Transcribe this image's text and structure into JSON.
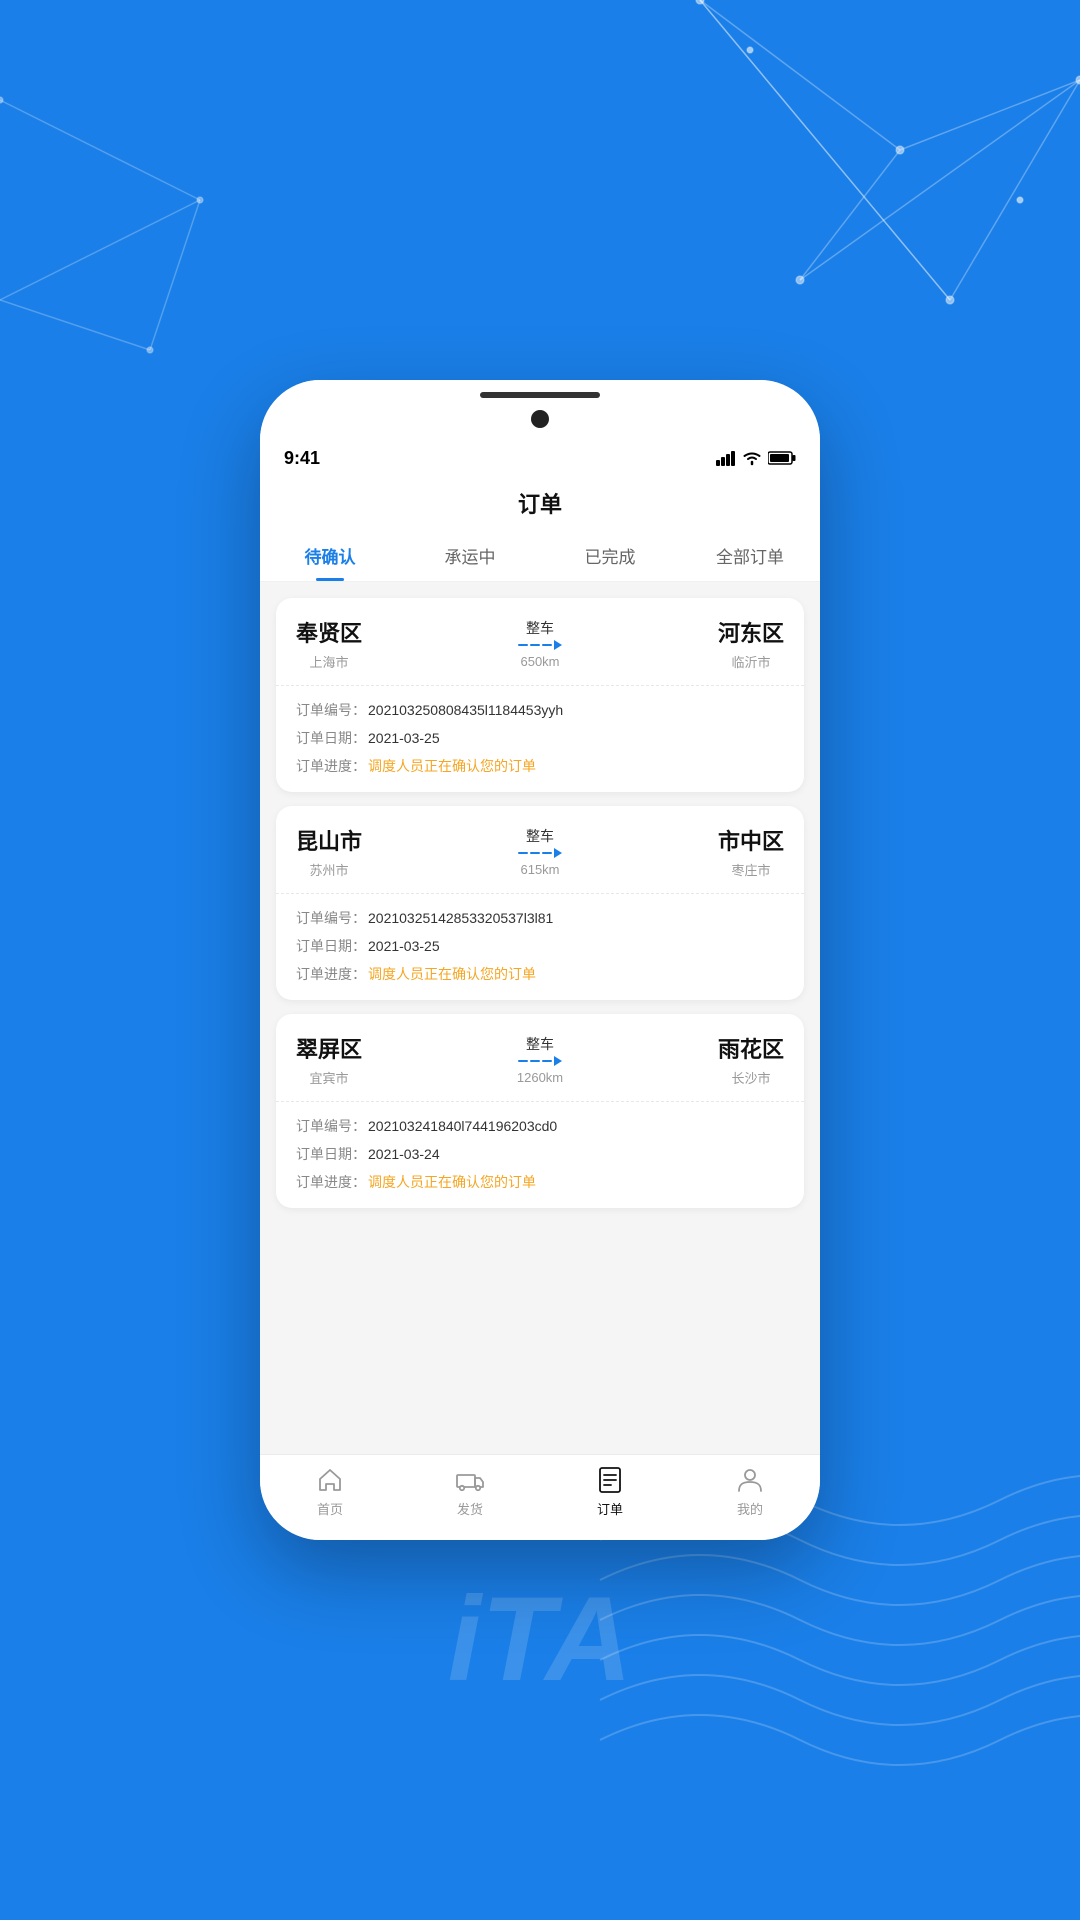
{
  "background": {
    "color": "#1a7fe8"
  },
  "status_bar": {
    "time": "9:41",
    "signal": "signal-icon",
    "wifi": "wifi-icon",
    "battery": "battery-icon"
  },
  "page": {
    "title": "订单"
  },
  "tabs": [
    {
      "id": "pending",
      "label": "待确认",
      "active": true
    },
    {
      "id": "transit",
      "label": "承运中",
      "active": false
    },
    {
      "id": "completed",
      "label": "已完成",
      "active": false
    },
    {
      "id": "all",
      "label": "全部订单",
      "active": false
    }
  ],
  "orders": [
    {
      "id": "order-1",
      "from_city": "奉贤区",
      "from_region": "上海市",
      "to_city": "河东区",
      "to_region": "临沂市",
      "route_type": "整车",
      "distance": "650km",
      "order_no_label": "订单编号：",
      "order_no": "202103250808435l1184453yyh",
      "order_date_label": "订单日期：",
      "order_date": "2021-03-25",
      "order_progress_label": "订单进度：",
      "order_progress": "调度人员正在确认您的订单"
    },
    {
      "id": "order-2",
      "from_city": "昆山市",
      "from_region": "苏州市",
      "to_city": "市中区",
      "to_region": "枣庄市",
      "route_type": "整车",
      "distance": "615km",
      "order_no_label": "订单编号：",
      "order_no": "20210325142853320537l3l81",
      "order_date_label": "订单日期：",
      "order_date": "2021-03-25",
      "order_progress_label": "订单进度：",
      "order_progress": "调度人员正在确认您的订单"
    },
    {
      "id": "order-3",
      "from_city": "翠屏区",
      "from_region": "宜宾市",
      "to_city": "雨花区",
      "to_region": "长沙市",
      "route_type": "整车",
      "distance": "1260km",
      "order_no_label": "订单编号：",
      "order_no": "202103241840l744196203cd0",
      "order_date_label": "订单日期：",
      "order_date": "2021-03-24",
      "order_progress_label": "订单进度：",
      "order_progress": "调度人员正在确认您的订单"
    }
  ],
  "bottom_nav": [
    {
      "id": "home",
      "label": "首页",
      "active": false,
      "icon": "home-icon"
    },
    {
      "id": "ship",
      "label": "发货",
      "active": false,
      "icon": "truck-icon"
    },
    {
      "id": "order",
      "label": "订单",
      "active": true,
      "icon": "order-icon"
    },
    {
      "id": "mine",
      "label": "我的",
      "active": false,
      "icon": "user-icon"
    }
  ]
}
